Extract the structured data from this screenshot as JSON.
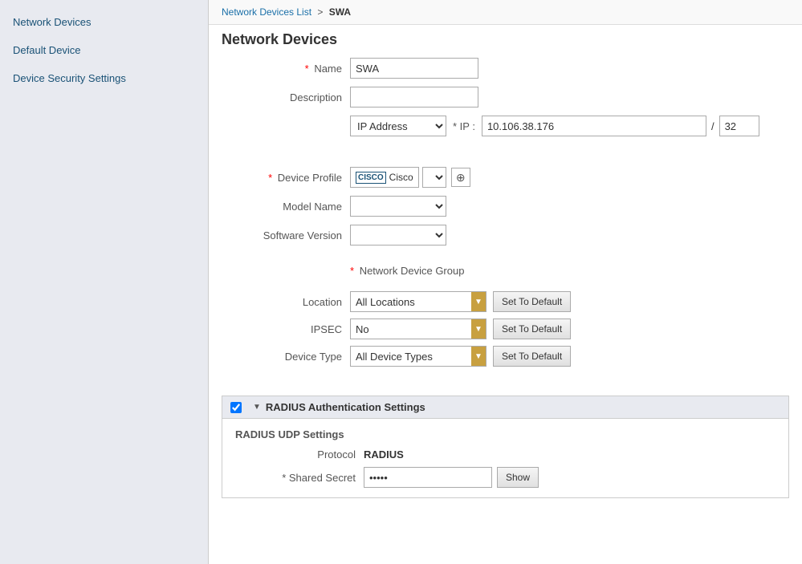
{
  "sidebar": {
    "items": [
      {
        "id": "network-devices",
        "label": "Network Devices"
      },
      {
        "id": "default-device",
        "label": "Default Device"
      },
      {
        "id": "device-security-settings",
        "label": "Device Security Settings"
      }
    ]
  },
  "breadcrumb": {
    "link_label": "Network Devices List",
    "separator": ">",
    "current": "SWA"
  },
  "page": {
    "title": "Network Devices"
  },
  "form": {
    "name_label": "Name",
    "name_value": "SWA",
    "desc_label": "Description",
    "desc_value": "",
    "ip_type_label": "IP Address",
    "ip_label": "* IP :",
    "ip_value": "10.106.38.176",
    "cidr_value": "32",
    "device_profile_label": "Device Profile",
    "cisco_text": "Cisco",
    "model_name_label": "Model Name",
    "software_version_label": "Software Version",
    "ndg_label": "Network Device Group",
    "location_label": "Location",
    "location_value": "All Locations",
    "ipsec_label": "IPSEC",
    "ipsec_value": "No",
    "device_type_label": "Device Type",
    "device_type_value": "All Device Types",
    "set_default_label": "Set To Default",
    "radius_section_title": "RADIUS Authentication Settings",
    "radius_udp_title": "RADIUS UDP Settings",
    "protocol_label": "Protocol",
    "protocol_value": "RADIUS",
    "shared_secret_label": "* Shared Secret",
    "shared_secret_value": "•••••",
    "show_btn_label": "Show",
    "globe_icon": "⊕"
  }
}
